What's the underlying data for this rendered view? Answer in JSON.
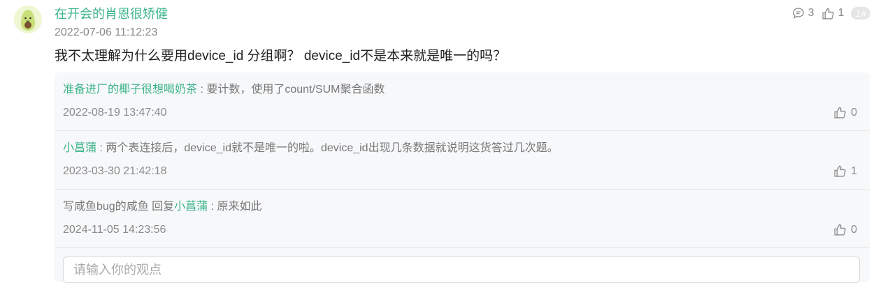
{
  "post": {
    "author": "在开会的肖恩很矫健",
    "time": "2022-07-06 11:12:23",
    "content": "我不太理解为什么要用device_id 分组啊？ device_id不是本来就是唯一的吗？",
    "comment_count": "3",
    "like_count": "1",
    "floor": "1#"
  },
  "replies": [
    {
      "name": "准备进厂的椰子很想喝奶茶",
      "sep": " : ",
      "text": "要计数，使用了count/SUM聚合函数",
      "time": "2022-08-19 13:47:40",
      "likes": "0"
    },
    {
      "name": "小菖蒲",
      "sep": " : ",
      "text": "两个表连接后，device_id就不是唯一的啦。device_id出现几条数据就说明这货答过几次题。",
      "time": "2023-03-30 21:42:18",
      "likes": "1"
    },
    {
      "name_plain": "写咸鱼bug的咸鱼",
      "reply_word": " 回复",
      "name": "小菖蒲",
      "sep": " : ",
      "text": "原来如此",
      "time": "2024-11-05 14:23:56",
      "likes": "0"
    }
  ],
  "input": {
    "placeholder": "请输入你的观点"
  },
  "colors": {
    "accent": "#3cb48a",
    "muted": "#8a8a8a",
    "reply_bg": "#f7f8fa"
  },
  "icons": {
    "comment": "comment-icon",
    "like": "thumbs-up-icon",
    "avatar": "avocado-avatar"
  }
}
